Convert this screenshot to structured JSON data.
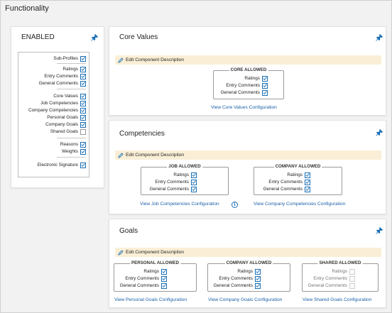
{
  "page": {
    "title": "Functionality"
  },
  "enabled": {
    "title": "ENABLED",
    "items": [
      {
        "label": "Sub-Profiles",
        "checked": true
      },
      {
        "label": "Ratings",
        "checked": true
      },
      {
        "label": "Entry Comments",
        "checked": true
      },
      {
        "label": "General Comments",
        "checked": true
      },
      {
        "label": "Core Values",
        "checked": true
      },
      {
        "label": "Job Competencies",
        "checked": true
      },
      {
        "label": "Company Competencies",
        "checked": true
      },
      {
        "label": "Personal Goals",
        "checked": true
      },
      {
        "label": "Company Goals",
        "checked": true
      },
      {
        "label": "Shared Goals",
        "checked": false
      },
      {
        "label": "Reasons",
        "checked": true
      },
      {
        "label": "Weights",
        "checked": true
      },
      {
        "label": "Electronic Signature",
        "checked": true
      }
    ]
  },
  "core_values": {
    "title": "Core Values",
    "edit_label": "Edit Component Description",
    "groups": [
      {
        "legend": "CORE ALLOWED",
        "rows": [
          {
            "label": "Ratings",
            "checked": true
          },
          {
            "label": "Entry Comments",
            "checked": true
          },
          {
            "label": "General Comments",
            "checked": true
          }
        ]
      }
    ],
    "links": [
      "View Core Values Configuration"
    ]
  },
  "competencies": {
    "title": "Competencies",
    "edit_label": "Edit Component Description",
    "groups": [
      {
        "legend": "JOB ALLOWED",
        "rows": [
          {
            "label": "Ratings",
            "checked": true
          },
          {
            "label": "Entry Comments",
            "checked": true
          },
          {
            "label": "General Comments",
            "checked": true
          }
        ]
      },
      {
        "legend": "COMPANY ALLOWED",
        "rows": [
          {
            "label": "Ratings",
            "checked": true
          },
          {
            "label": "Entry Comments",
            "checked": true
          },
          {
            "label": "General Comments",
            "checked": true
          }
        ]
      }
    ],
    "links": [
      "View Job Competencies Configuration",
      "View Company Competencies Configuration"
    ],
    "info_glyph": "i"
  },
  "goals": {
    "title": "Goals",
    "edit_label": "Edit Component Description",
    "groups": [
      {
        "legend": "PERSONAL ALLOWED",
        "rows": [
          {
            "label": "Ratings",
            "checked": true
          },
          {
            "label": "Entry Comments",
            "checked": true
          },
          {
            "label": "General Comments",
            "checked": true
          }
        ]
      },
      {
        "legend": "COMPANY ALLOWED",
        "rows": [
          {
            "label": "Ratings",
            "checked": true
          },
          {
            "label": "Entry Comments",
            "checked": true
          },
          {
            "label": "General Comments",
            "checked": true
          }
        ]
      },
      {
        "legend": "SHARED ALLOWED",
        "rows": [
          {
            "label": "Ratings",
            "checked": false
          },
          {
            "label": "Entry Comments",
            "checked": false
          },
          {
            "label": "General Comments",
            "checked": false
          }
        ]
      }
    ],
    "links": [
      "View Personal Goals Configuration",
      "View Company Goals Configuration",
      "View Shared Goals Configuration"
    ]
  },
  "colors": {
    "accent": "#1a6fb5",
    "link": "#1a5fa8",
    "edit_bar": "#faefd6",
    "background": "#f2f2f2"
  },
  "icons": {
    "pin": "pin-icon",
    "pencil": "pencil-icon",
    "check": "checkmark-icon",
    "info": "info-icon"
  }
}
